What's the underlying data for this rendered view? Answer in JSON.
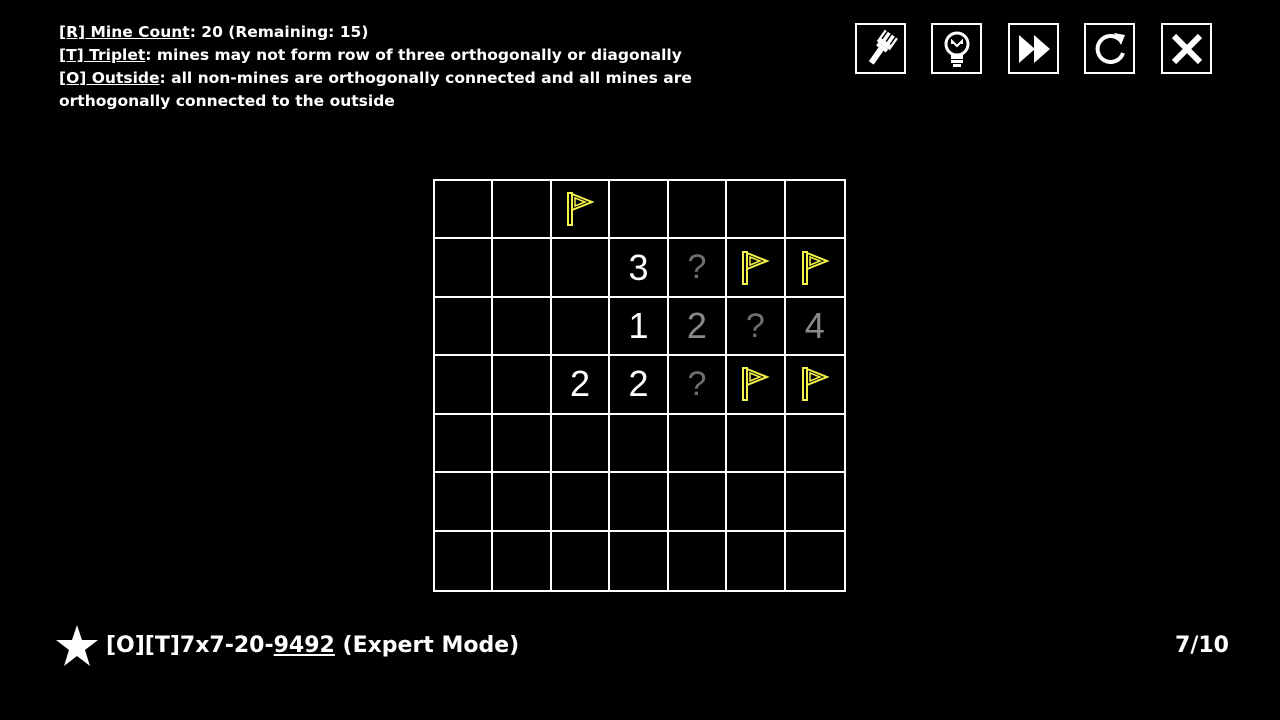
{
  "rules": {
    "mine_count": {
      "tag": "[R] Mine Count",
      "text": ":  20 (Remaining: 15)"
    },
    "triplet": {
      "tag": "[T] Triplet",
      "text": ": mines may not form row of three orthogonally or diagonally"
    },
    "outside": {
      "tag": "[O] Outside",
      "text": ": all non-mines are orthogonally connected and all mines are orthogonally connected to the outside"
    }
  },
  "toolbar": {
    "buttons": [
      {
        "name": "brush-button",
        "icon": "brush-icon"
      },
      {
        "name": "hint-button",
        "icon": "lightbulb-icon"
      },
      {
        "name": "skip-button",
        "icon": "fast-forward-icon"
      },
      {
        "name": "restart-button",
        "icon": "restart-icon"
      },
      {
        "name": "close-button",
        "icon": "close-icon"
      }
    ]
  },
  "board": {
    "size": 7,
    "flag_color": "#f2f24a",
    "rows": [
      [
        "",
        "",
        "F",
        "",
        "",
        "",
        ""
      ],
      [
        "",
        "",
        "",
        "3",
        "?",
        "F",
        "F"
      ],
      [
        "",
        "",
        "",
        "1",
        "2d",
        "?",
        "4d"
      ],
      [
        "",
        "",
        "2",
        "2",
        "?",
        "F",
        "F"
      ],
      [
        "",
        "",
        "",
        "",
        "",
        "",
        ""
      ],
      [
        "",
        "",
        "",
        "",
        "",
        "",
        ""
      ],
      [
        "",
        "",
        "",
        "",
        "",
        "",
        ""
      ]
    ]
  },
  "footer": {
    "star_icon": "star-icon",
    "puzzle_prefix": "[O][T]7x7-20-",
    "puzzle_seed": "9492",
    "puzzle_suffix": " (Expert Mode)",
    "progress": "7/10"
  }
}
